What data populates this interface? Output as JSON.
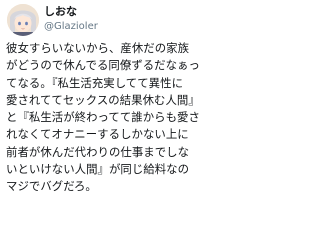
{
  "user": {
    "display_name": "しおな",
    "handle": "@Glazioler",
    "avatar_icon": "anime-avatar-icon"
  },
  "tweet": {
    "lines": [
      "彼女すらいないから、産休だの家族",
      "がどうので休んでる同僚ずるだなぁっ",
      "てなる。『私生活充実してて異性に",
      "愛されててセックスの結果休む人間』",
      "と『私生活が終わってて誰からも愛さ",
      "れなくてオナニーするしかない上に",
      "前者が休んだ代わりの仕事までしな",
      "いといけない人間』が同じ給料なの",
      "マジでバグだろ。"
    ]
  }
}
